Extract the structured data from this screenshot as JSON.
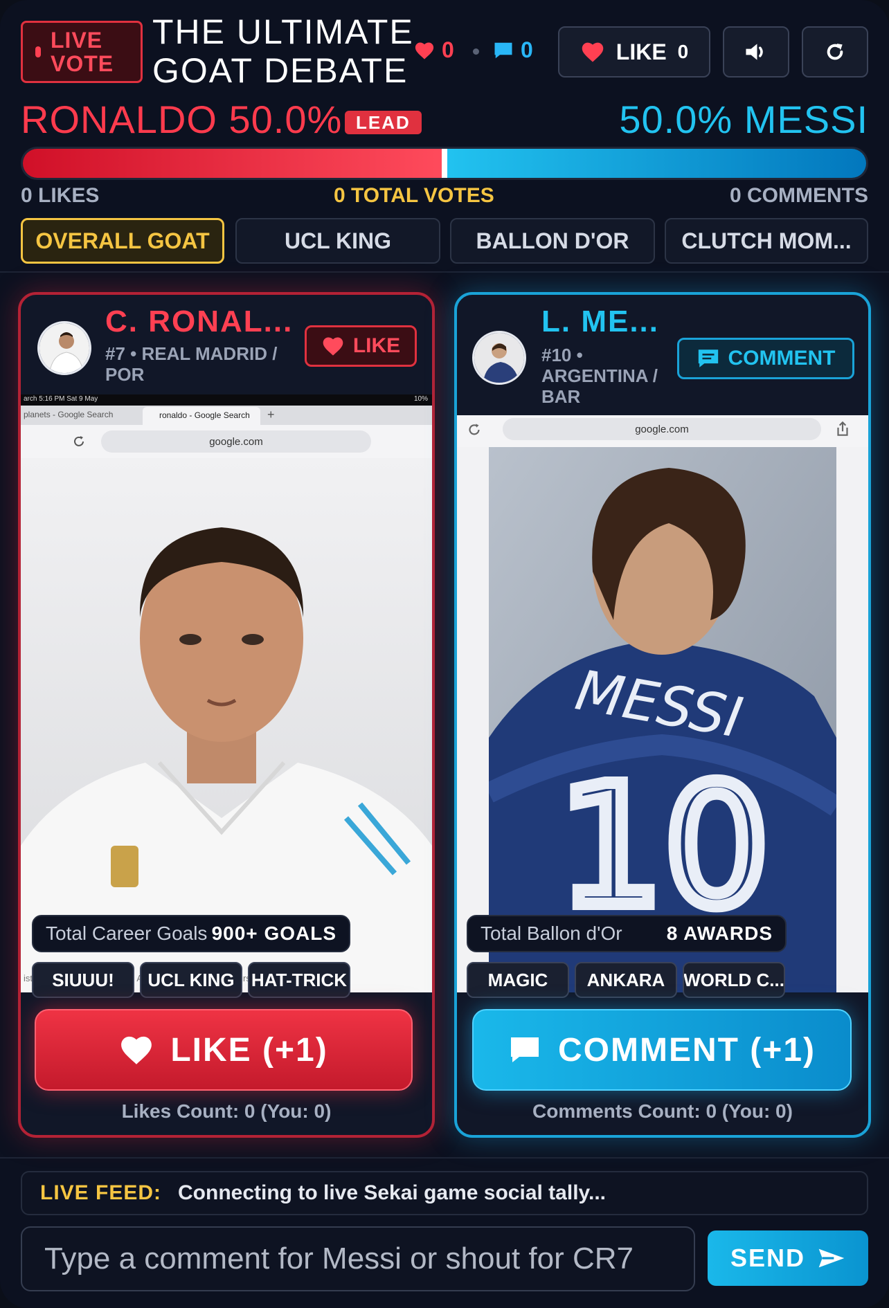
{
  "header": {
    "live_badge": "LIVE VOTE",
    "title_line1": "THE ULTIMATE",
    "title_line2": "GOAT DEBATE",
    "heart_count": "0",
    "comment_count": "0",
    "like_button_label": "LIKE",
    "like_button_count": "0"
  },
  "score": {
    "left_label": "RONALDO 50.0%",
    "lead_badge": "LEAD",
    "right_label": "50.0% MESSI",
    "left_share": 0.5,
    "likes_total": "0 LIKES",
    "votes_total": "0 TOTAL VOTES",
    "comments_total": "0 COMMENTS"
  },
  "tabs": [
    {
      "label": "OVERALL GOAT",
      "active": true
    },
    {
      "label": "UCL KING",
      "active": false
    },
    {
      "label": "BALLON D'OR",
      "active": false
    },
    {
      "label": "CLUTCH MOM...",
      "active": false
    }
  ],
  "ronaldo": {
    "name": "C. RONAL...",
    "meta_line1": "#7 • REAL MADRID /",
    "meta_line2": "POR",
    "action_button": "LIKE",
    "browser": {
      "status_time": "arch   5:16 PM   Sat 9 May",
      "status_battery": "10%",
      "tab1": "planets - Google Search",
      "tab2": "ronaldo - Google Search",
      "url": "google.com",
      "caption": "istiano Ronaldo Dos Santos Aveiro - History and honours"
    },
    "stat_label": "Total Career Goals",
    "stat_value": "900+ GOALS",
    "chips": [
      "SIUUU!",
      "UCL KING",
      "HAT-TRICK"
    ],
    "big_button": "LIKE (+1)",
    "count_text": "Likes Count: 0 (You: 0)"
  },
  "messi": {
    "name": "L. ME...",
    "meta_line1": "#10 •",
    "meta_line2": "ARGENTINA /",
    "meta_line3": "BAR",
    "action_button": "COMMENT",
    "browser": {
      "url": "google.com"
    },
    "jersey_text": "MESSI",
    "jersey_number": "10",
    "stat_label": "Total Ballon d'Or",
    "stat_value": "8 AWARDS",
    "chips": [
      "MAGIC",
      "ANKARA",
      "WORLD C..."
    ],
    "big_button": "COMMENT (+1)",
    "count_text": "Comments Count: 0 (You: 0)"
  },
  "feed": {
    "label": "LIVE FEED:",
    "text": "Connecting to live Sekai game social tally..."
  },
  "composer": {
    "placeholder": "Type a comment for Messi or shout for CR7",
    "send_label": "SEND"
  },
  "colors": {
    "ronaldo_accent": "#ff3b4d",
    "messi_accent": "#22c3f0",
    "gold": "#f5c542",
    "background": "#0c1120"
  }
}
